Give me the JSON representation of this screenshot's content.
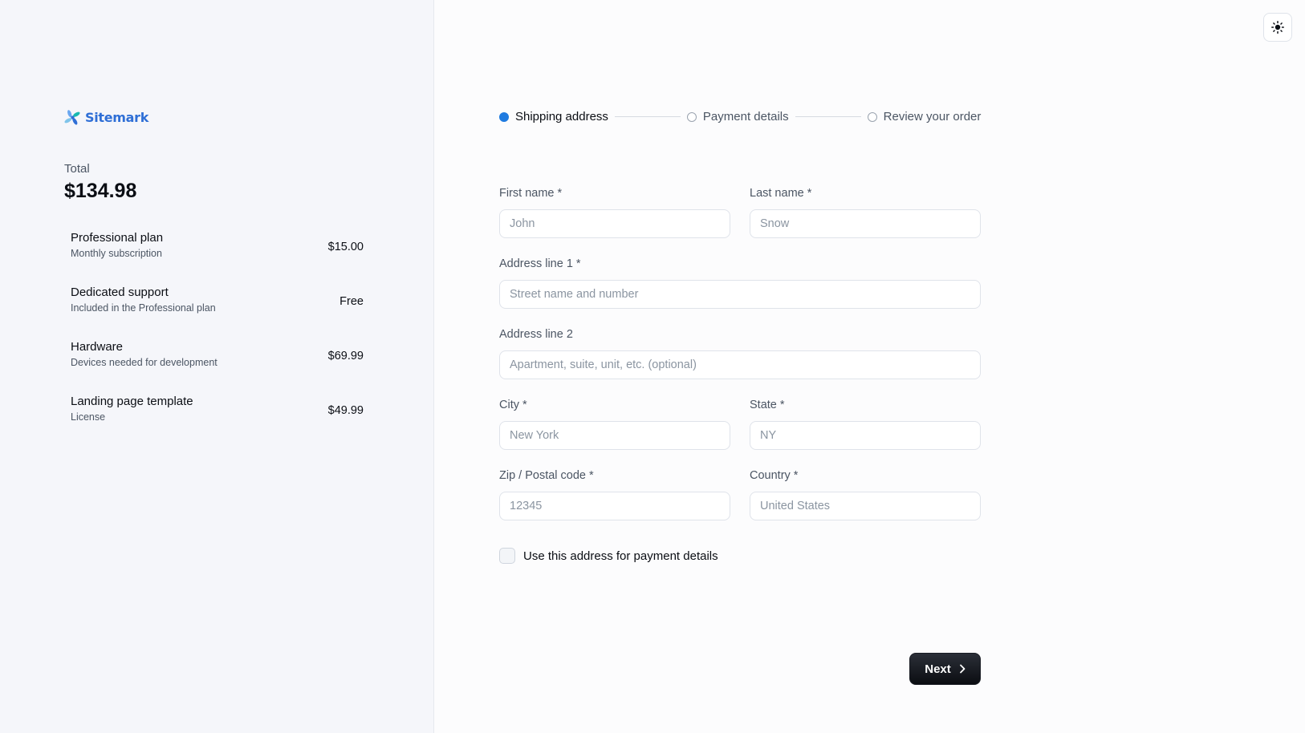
{
  "brand": {
    "name": "Sitemark"
  },
  "summary": {
    "total_label": "Total",
    "total_amount": "$134.98",
    "items": [
      {
        "name": "Professional plan",
        "desc": "Monthly subscription",
        "price": "$15.00"
      },
      {
        "name": "Dedicated support",
        "desc": "Included in the Professional plan",
        "price": "Free"
      },
      {
        "name": "Hardware",
        "desc": "Devices needed for development",
        "price": "$69.99"
      },
      {
        "name": "Landing page template",
        "desc": "License",
        "price": "$49.99"
      }
    ]
  },
  "theme_toggle": {
    "icon": "sun-icon"
  },
  "stepper": {
    "steps": [
      {
        "label": "Shipping address",
        "active": true
      },
      {
        "label": "Payment details",
        "active": false
      },
      {
        "label": "Review your order",
        "active": false
      }
    ]
  },
  "form": {
    "first_name": {
      "label": "First name *",
      "placeholder": "John",
      "value": ""
    },
    "last_name": {
      "label": "Last name *",
      "placeholder": "Snow",
      "value": ""
    },
    "address1": {
      "label": "Address line 1 *",
      "placeholder": "Street name and number",
      "value": ""
    },
    "address2": {
      "label": "Address line 2",
      "placeholder": "Apartment, suite, unit, etc. (optional)",
      "value": ""
    },
    "city": {
      "label": "City *",
      "placeholder": "New York",
      "value": ""
    },
    "state": {
      "label": "State *",
      "placeholder": "NY",
      "value": ""
    },
    "zip": {
      "label": "Zip / Postal code *",
      "placeholder": "12345",
      "value": ""
    },
    "country": {
      "label": "Country *",
      "placeholder": "United States",
      "value": ""
    },
    "use_for_payment": {
      "label": "Use this address for payment details",
      "checked": false
    }
  },
  "actions": {
    "next_label": "Next"
  },
  "colors": {
    "accent": "#1f7be0",
    "brand": "#2f6fd6",
    "button_bg": "#0b0d12"
  }
}
